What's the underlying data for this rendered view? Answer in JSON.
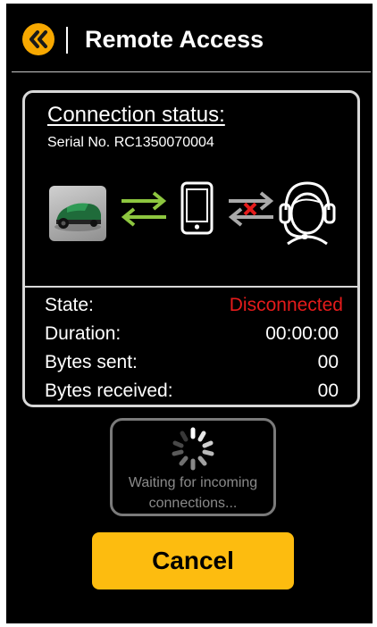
{
  "header": {
    "title": "Remote Access",
    "back_icon": "double-chevron-left-icon",
    "accent_color": "#f7a800"
  },
  "connection": {
    "heading": "Connection status:",
    "serial": "Serial No. RC1350070004",
    "diagram": {
      "device_icon": "robotic-mower-icon",
      "device_link": "arrows-exchange-icon",
      "device_link_color": "#8dc63f",
      "phone_icon": "smartphone-icon",
      "support_link": "arrows-exchange-broken-icon",
      "support_link_error_color": "#e41b1b",
      "support_icon": "headset-agent-icon"
    },
    "stats": [
      {
        "label": "State:",
        "value": "Disconnected",
        "color": "#e41b1b"
      },
      {
        "label": "Duration:",
        "value": "00:00:00"
      },
      {
        "label": "Bytes sent:",
        "value": "00"
      },
      {
        "label": "Bytes received:",
        "value": "00"
      }
    ]
  },
  "waiting": {
    "icon": "loading-spinner-icon",
    "text": "Waiting for incoming connections..."
  },
  "actions": {
    "cancel_label": "Cancel",
    "cancel_color": "#fdbc0f"
  }
}
